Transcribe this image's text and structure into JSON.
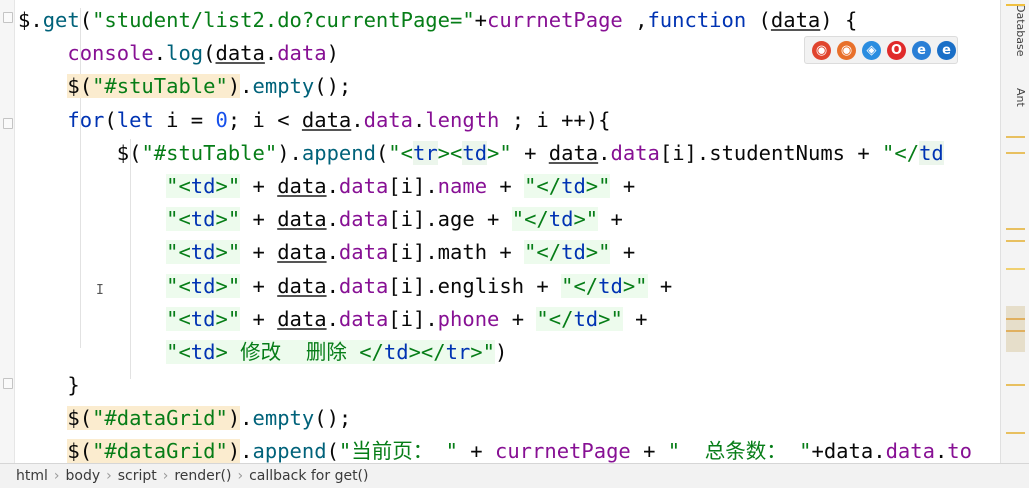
{
  "code_lines": [
    {
      "indent": 0,
      "tokens": [
        {
          "t": "$.",
          "c": "plain"
        },
        {
          "t": "get",
          "c": "fn"
        },
        {
          "t": "(",
          "c": "plain"
        },
        {
          "t": "\"student/list2.do?currentPage=\"",
          "c": "str"
        },
        {
          "t": "+",
          "c": "plain"
        },
        {
          "t": "currnetPage",
          "c": "field"
        },
        {
          "t": " ,",
          "c": "plain"
        },
        {
          "t": "function",
          "c": "kw"
        },
        {
          "t": " (",
          "c": "plain"
        },
        {
          "t": "data",
          "c": "param"
        },
        {
          "t": ") {",
          "c": "plain"
        }
      ]
    },
    {
      "indent": 2,
      "tokens": [
        {
          "t": "console",
          "c": "field"
        },
        {
          "t": ".",
          "c": "plain"
        },
        {
          "t": "log",
          "c": "fn"
        },
        {
          "t": "(",
          "c": "plain"
        },
        {
          "t": "data",
          "c": "param"
        },
        {
          "t": ".",
          "c": "plain"
        },
        {
          "t": "data",
          "c": "field"
        },
        {
          "t": ")",
          "c": "plain"
        }
      ]
    },
    {
      "indent": 2,
      "tokens": [
        {
          "t": "$(",
          "c": "plain",
          "hl": "sel"
        },
        {
          "t": "\"#stuTable\"",
          "c": "str",
          "hl": "sel"
        },
        {
          "t": ")",
          "c": "plain",
          "hl": "sel"
        },
        {
          "t": ".",
          "c": "plain"
        },
        {
          "t": "empty",
          "c": "fn"
        },
        {
          "t": "();",
          "c": "plain"
        }
      ]
    },
    {
      "indent": 2,
      "tokens": [
        {
          "t": "for",
          "c": "kw"
        },
        {
          "t": "(",
          "c": "plain"
        },
        {
          "t": "let",
          "c": "kw"
        },
        {
          "t": " i = ",
          "c": "plain"
        },
        {
          "t": "0",
          "c": "num"
        },
        {
          "t": "; i < ",
          "c": "plain"
        },
        {
          "t": "data",
          "c": "param"
        },
        {
          "t": ".",
          "c": "plain"
        },
        {
          "t": "data",
          "c": "field"
        },
        {
          "t": ".",
          "c": "plain"
        },
        {
          "t": "length",
          "c": "field"
        },
        {
          "t": " ; i ++){",
          "c": "plain"
        }
      ]
    },
    {
      "indent": 4,
      "tokens": [
        {
          "t": "$(",
          "c": "plain"
        },
        {
          "t": "\"#stuTable\"",
          "c": "str"
        },
        {
          "t": ").",
          "c": "plain"
        },
        {
          "t": "append",
          "c": "fn"
        },
        {
          "t": "(",
          "c": "plain"
        },
        {
          "t": "\"<",
          "c": "str"
        },
        {
          "t": "tr",
          "c": "tag",
          "hl": "tag"
        },
        {
          "t": "><",
          "c": "str"
        },
        {
          "t": "td",
          "c": "tag",
          "hl": "tag"
        },
        {
          "t": ">\"",
          "c": "str"
        },
        {
          "t": " + ",
          "c": "plain"
        },
        {
          "t": "data",
          "c": "param"
        },
        {
          "t": ".",
          "c": "plain"
        },
        {
          "t": "data",
          "c": "field"
        },
        {
          "t": "[i].",
          "c": "plain"
        },
        {
          "t": "studentNums",
          "c": "plain"
        },
        {
          "t": " + ",
          "c": "plain"
        },
        {
          "t": "\"</",
          "c": "str"
        },
        {
          "t": "td",
          "c": "tag",
          "hl": "tag"
        }
      ]
    },
    {
      "indent": 6,
      "tokens": [
        {
          "t": "\"<",
          "c": "str",
          "hl": "code"
        },
        {
          "t": "td",
          "c": "tag",
          "hl": "code"
        },
        {
          "t": ">\"",
          "c": "str",
          "hl": "code"
        },
        {
          "t": " + ",
          "c": "plain"
        },
        {
          "t": "data",
          "c": "param"
        },
        {
          "t": ".",
          "c": "plain"
        },
        {
          "t": "data",
          "c": "field"
        },
        {
          "t": "[i].",
          "c": "plain"
        },
        {
          "t": "name",
          "c": "field"
        },
        {
          "t": " + ",
          "c": "plain"
        },
        {
          "t": "\"</",
          "c": "str",
          "hl": "code"
        },
        {
          "t": "td",
          "c": "tag",
          "hl": "code"
        },
        {
          "t": ">\"",
          "c": "str",
          "hl": "code"
        },
        {
          "t": " +",
          "c": "plain"
        }
      ]
    },
    {
      "indent": 6,
      "tokens": [
        {
          "t": "\"<",
          "c": "str",
          "hl": "code"
        },
        {
          "t": "td",
          "c": "tag",
          "hl": "code"
        },
        {
          "t": ">\"",
          "c": "str",
          "hl": "code"
        },
        {
          "t": " + ",
          "c": "plain"
        },
        {
          "t": "data",
          "c": "param"
        },
        {
          "t": ".",
          "c": "plain"
        },
        {
          "t": "data",
          "c": "field"
        },
        {
          "t": "[i].",
          "c": "plain"
        },
        {
          "t": "age",
          "c": "plain"
        },
        {
          "t": " + ",
          "c": "plain"
        },
        {
          "t": "\"</",
          "c": "str",
          "hl": "code"
        },
        {
          "t": "td",
          "c": "tag",
          "hl": "code"
        },
        {
          "t": ">\"",
          "c": "str",
          "hl": "code"
        },
        {
          "t": " +",
          "c": "plain"
        }
      ]
    },
    {
      "indent": 6,
      "tokens": [
        {
          "t": "\"<",
          "c": "str",
          "hl": "code"
        },
        {
          "t": "td",
          "c": "tag",
          "hl": "code"
        },
        {
          "t": ">\"",
          "c": "str",
          "hl": "code"
        },
        {
          "t": " + ",
          "c": "plain"
        },
        {
          "t": "data",
          "c": "param"
        },
        {
          "t": ".",
          "c": "plain"
        },
        {
          "t": "data",
          "c": "field"
        },
        {
          "t": "[i].",
          "c": "plain"
        },
        {
          "t": "math",
          "c": "plain"
        },
        {
          "t": " + ",
          "c": "plain"
        },
        {
          "t": "\"</",
          "c": "str",
          "hl": "code"
        },
        {
          "t": "td",
          "c": "tag",
          "hl": "code"
        },
        {
          "t": ">\"",
          "c": "str",
          "hl": "code"
        },
        {
          "t": " +",
          "c": "plain"
        }
      ]
    },
    {
      "indent": 6,
      "tokens": [
        {
          "t": "\"<",
          "c": "str",
          "hl": "code"
        },
        {
          "t": "td",
          "c": "tag",
          "hl": "code"
        },
        {
          "t": ">\"",
          "c": "str",
          "hl": "code"
        },
        {
          "t": " + ",
          "c": "plain"
        },
        {
          "t": "data",
          "c": "param"
        },
        {
          "t": ".",
          "c": "plain"
        },
        {
          "t": "data",
          "c": "field"
        },
        {
          "t": "[i].",
          "c": "plain"
        },
        {
          "t": "english",
          "c": "plain"
        },
        {
          "t": " + ",
          "c": "plain"
        },
        {
          "t": "\"</",
          "c": "str",
          "hl": "code"
        },
        {
          "t": "td",
          "c": "tag",
          "hl": "code"
        },
        {
          "t": ">\"",
          "c": "str",
          "hl": "code"
        },
        {
          "t": " +",
          "c": "plain"
        }
      ]
    },
    {
      "indent": 6,
      "tokens": [
        {
          "t": "\"<",
          "c": "str",
          "hl": "code"
        },
        {
          "t": "td",
          "c": "tag",
          "hl": "code"
        },
        {
          "t": ">\"",
          "c": "str",
          "hl": "code"
        },
        {
          "t": " + ",
          "c": "plain"
        },
        {
          "t": "data",
          "c": "param"
        },
        {
          "t": ".",
          "c": "plain"
        },
        {
          "t": "data",
          "c": "field"
        },
        {
          "t": "[i].",
          "c": "plain"
        },
        {
          "t": "phone",
          "c": "field"
        },
        {
          "t": " + ",
          "c": "plain"
        },
        {
          "t": "\"</",
          "c": "str",
          "hl": "code"
        },
        {
          "t": "td",
          "c": "tag",
          "hl": "code"
        },
        {
          "t": ">\"",
          "c": "str",
          "hl": "code"
        },
        {
          "t": " +",
          "c": "plain"
        }
      ]
    },
    {
      "indent": 6,
      "tokens": [
        {
          "t": "\"<",
          "c": "str",
          "hl": "code"
        },
        {
          "t": "td",
          "c": "tag",
          "hl": "code"
        },
        {
          "t": "> 修改  删除 </",
          "c": "str",
          "hl": "code"
        },
        {
          "t": "td",
          "c": "tag",
          "hl": "code"
        },
        {
          "t": "></",
          "c": "str",
          "hl": "code"
        },
        {
          "t": "tr",
          "c": "tag",
          "hl": "code"
        },
        {
          "t": ">\"",
          "c": "str",
          "hl": "code"
        },
        {
          "t": ")",
          "c": "plain"
        }
      ]
    },
    {
      "indent": 2,
      "tokens": [
        {
          "t": "}",
          "c": "plain"
        }
      ]
    },
    {
      "indent": 2,
      "tokens": [
        {
          "t": "$(",
          "c": "plain",
          "hl": "sel"
        },
        {
          "t": "\"#dataGrid\"",
          "c": "str",
          "hl": "sel"
        },
        {
          "t": ")",
          "c": "plain",
          "hl": "sel"
        },
        {
          "t": ".",
          "c": "plain"
        },
        {
          "t": "empty",
          "c": "fn"
        },
        {
          "t": "();",
          "c": "plain"
        }
      ]
    },
    {
      "indent": 2,
      "tokens": [
        {
          "t": "$(",
          "c": "plain",
          "hl": "sel"
        },
        {
          "t": "\"#dataGrid\"",
          "c": "str",
          "hl": "sel"
        },
        {
          "t": ")",
          "c": "plain",
          "hl": "sel"
        },
        {
          "t": ".",
          "c": "plain"
        },
        {
          "t": "append",
          "c": "fn"
        },
        {
          "t": "(",
          "c": "plain"
        },
        {
          "t": "\"当前页： \"",
          "c": "str"
        },
        {
          "t": " + ",
          "c": "plain"
        },
        {
          "t": "currnetPage",
          "c": "field"
        },
        {
          "t": " + ",
          "c": "plain"
        },
        {
          "t": "\"  总条数： \"",
          "c": "str"
        },
        {
          "t": "+",
          "c": "plain"
        },
        {
          "t": "data",
          "c": "plain"
        },
        {
          "t": ".",
          "c": "plain"
        },
        {
          "t": "data",
          "c": "field"
        },
        {
          "t": ".",
          "c": "plain"
        },
        {
          "t": "to",
          "c": "field"
        }
      ]
    }
  ],
  "browser_icons": [
    {
      "name": "chrome-icon",
      "color": "#e0442e",
      "glyph": "◉"
    },
    {
      "name": "firefox-icon",
      "color": "#e8702a",
      "glyph": "◉"
    },
    {
      "name": "safari-icon",
      "color": "#2a8de0",
      "glyph": "◈"
    },
    {
      "name": "opera-icon",
      "color": "#e02a2a",
      "glyph": "O"
    },
    {
      "name": "ie-icon",
      "color": "#2a7fd6",
      "glyph": "e"
    },
    {
      "name": "edge-icon",
      "color": "#1a6fc7",
      "glyph": "e"
    }
  ],
  "side_panel": {
    "database_label": "Database",
    "ant_label": "Ant"
  },
  "breadcrumb": [
    "html",
    "body",
    "script",
    "render()",
    "callback for get()"
  ]
}
